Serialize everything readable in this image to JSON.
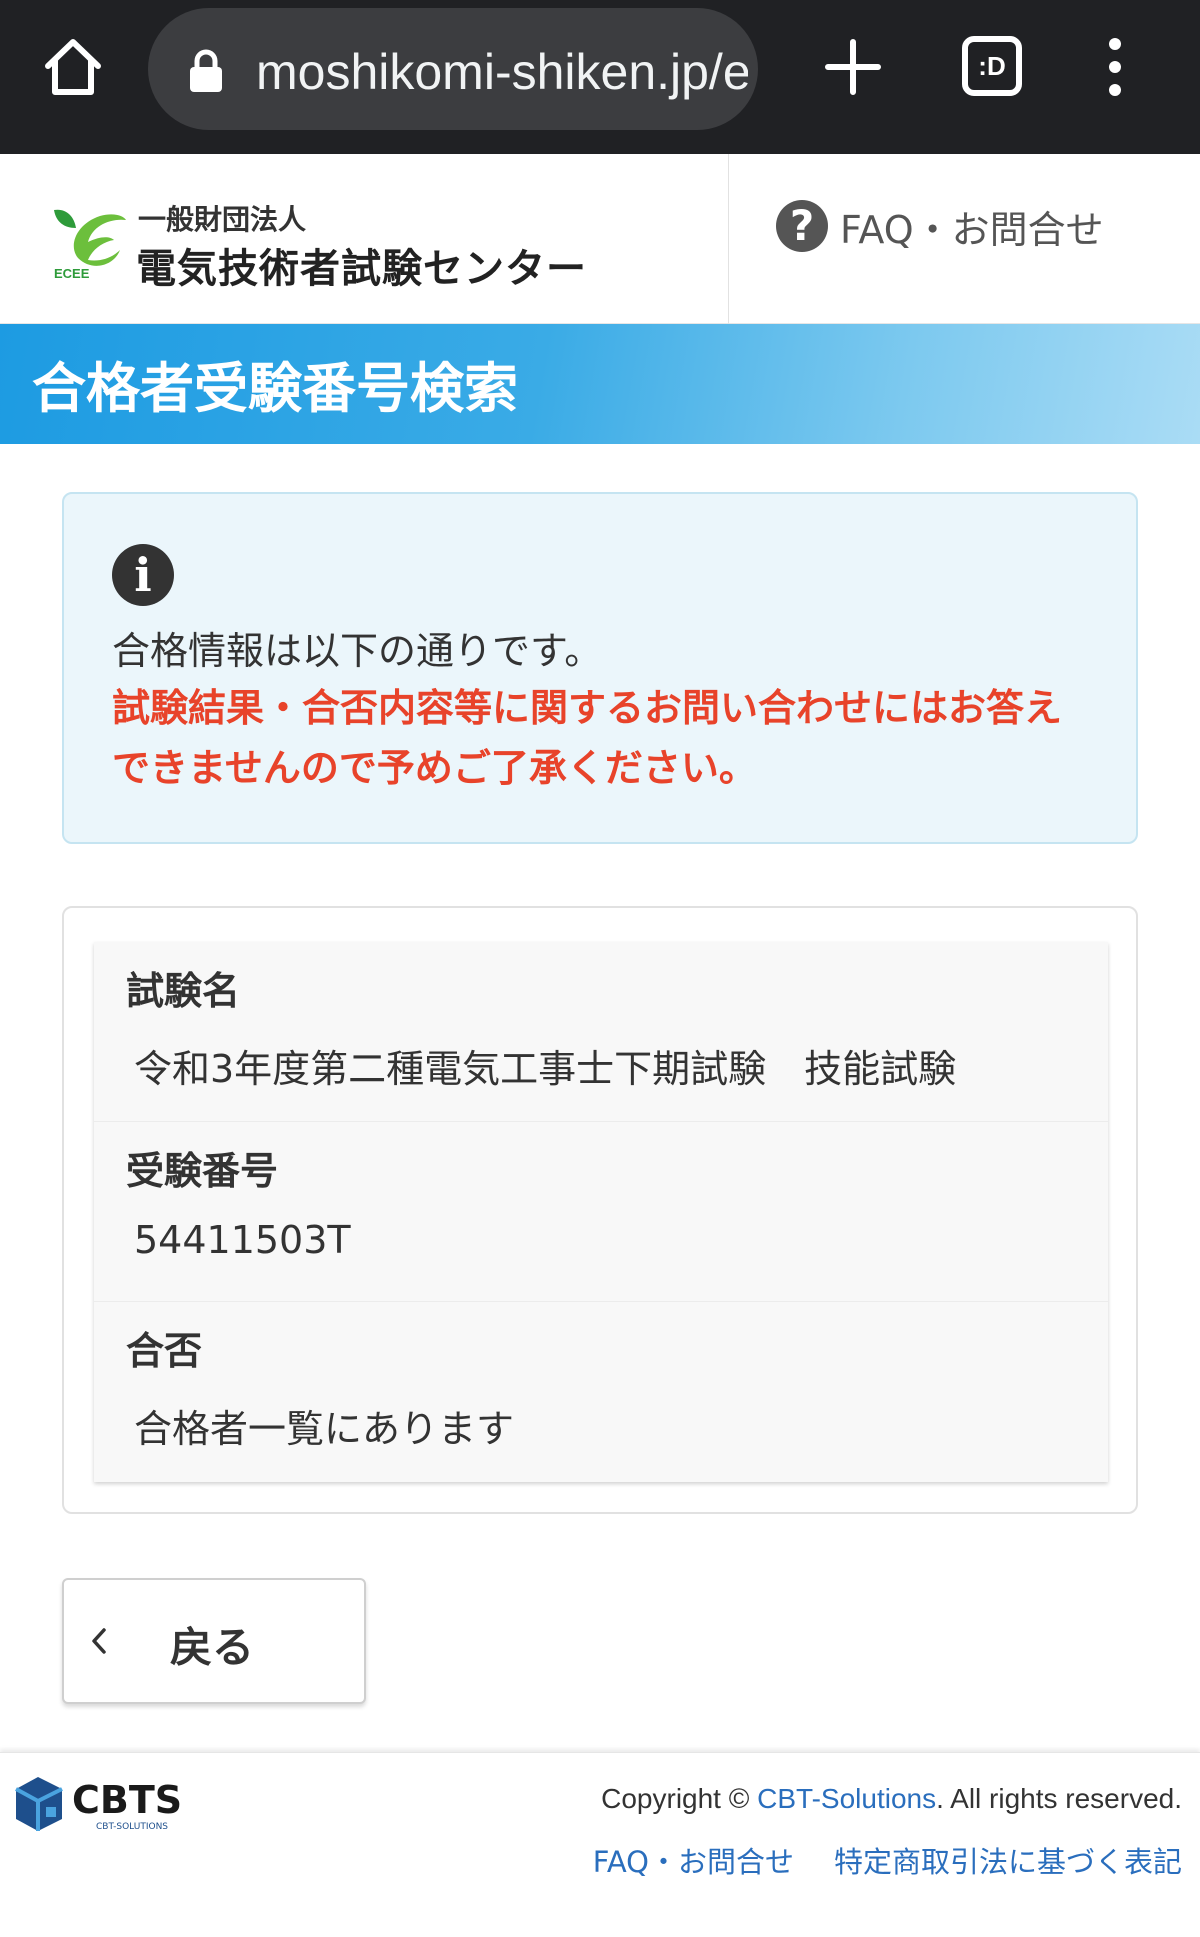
{
  "browser": {
    "url": "moshikomi-shiken.jp/ecee/result",
    "tabs_label": ":D",
    "icons": [
      "home-icon",
      "lock-icon",
      "plus-icon",
      "tab-switcher-icon",
      "more-vert-icon"
    ]
  },
  "header": {
    "org_small": "一般財団法人",
    "org_large": "電気技術者試験センター",
    "logo_text": "ECEE",
    "faq_icon": "?",
    "faq_label": "FAQ・お問合せ"
  },
  "banner": {
    "title": "合格者受験番号検索"
  },
  "info": {
    "icon": "i",
    "message": "合格情報は以下の通りです。",
    "warning": "試験結果・合否内容等に関するお問い合わせにはお答えできませんので予めご了承ください。"
  },
  "result": {
    "rows": [
      {
        "label": "試験名",
        "value": "令和3年度第二種電気工事士下期試験　技能試験"
      },
      {
        "label": "受験番号",
        "value": "54411503T"
      },
      {
        "label": "合否",
        "value": "合格者一覧にあります"
      }
    ]
  },
  "actions": {
    "back_label": "戻る"
  },
  "footer": {
    "logo_text": "CBTS",
    "logo_sub": "CBT-SOLUTIONS",
    "copyright_prefix": "Copyright © ",
    "copyright_link": "CBT-Solutions",
    "copyright_suffix": ". All rights reserved.",
    "link_faq": "FAQ・お問合せ",
    "link_law": "特定商取引法に基づく表記"
  },
  "colors": {
    "accent_blue": "#1d9be2",
    "warning_red": "#e8432a",
    "link_blue": "#2a6ebd",
    "info_bg": "#ebf6fb"
  }
}
